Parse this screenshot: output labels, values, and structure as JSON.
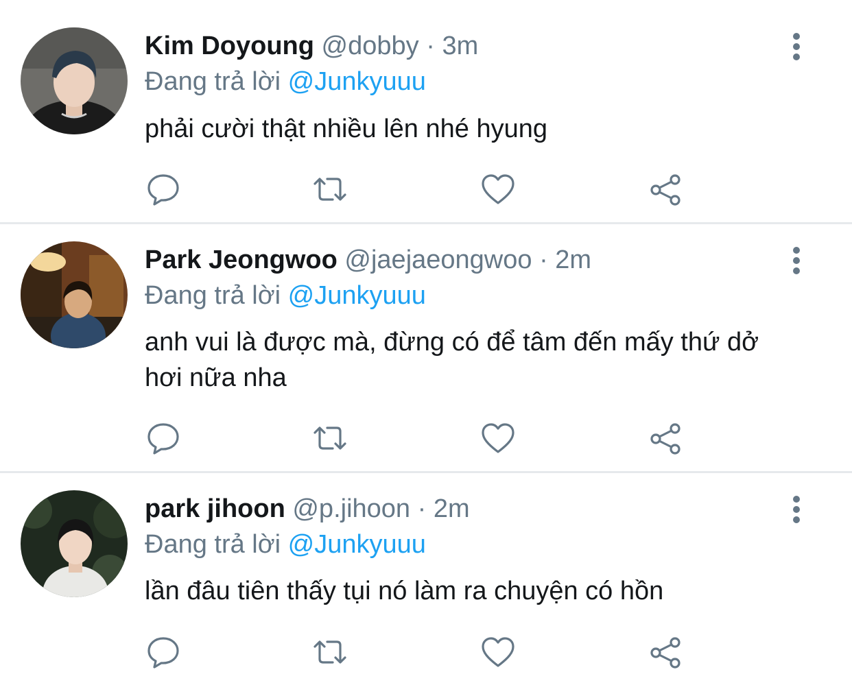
{
  "tweets": [
    {
      "name": "Kim Doyoung",
      "handle": "@dobby",
      "separator": "·",
      "time": "3m",
      "reply_prefix": "Đang trả lời",
      "reply_to": "@Junkyuuu",
      "text": "phải cười thật nhiều lên nhé hyung"
    },
    {
      "name": "Park Jeongwoo",
      "handle": "@jaejaeongwoo",
      "separator": "·",
      "time": "2m",
      "reply_prefix": "Đang trả lời",
      "reply_to": "@Junkyuuu",
      "text": "anh vui là được mà, đừng có để tâm đến mấy thứ dở hơi nữa nha"
    },
    {
      "name": "park jihoon",
      "handle": "@p.jihoon",
      "separator": "·",
      "time": "2m",
      "reply_prefix": "Đang trả lời",
      "reply_to": "@Junkyuuu",
      "text": "lần đâu tiên thấy tụi nó làm ra chuyện có hồn"
    }
  ],
  "icons": {
    "more": "more-vertical-icon",
    "reply": "comment-icon",
    "retweet": "retweet-icon",
    "like": "heart-icon",
    "share": "share-icon"
  },
  "colors": {
    "name": "#14171a",
    "secondary": "#657786",
    "mention": "#1da1f2",
    "divider": "#e6e9ec"
  }
}
